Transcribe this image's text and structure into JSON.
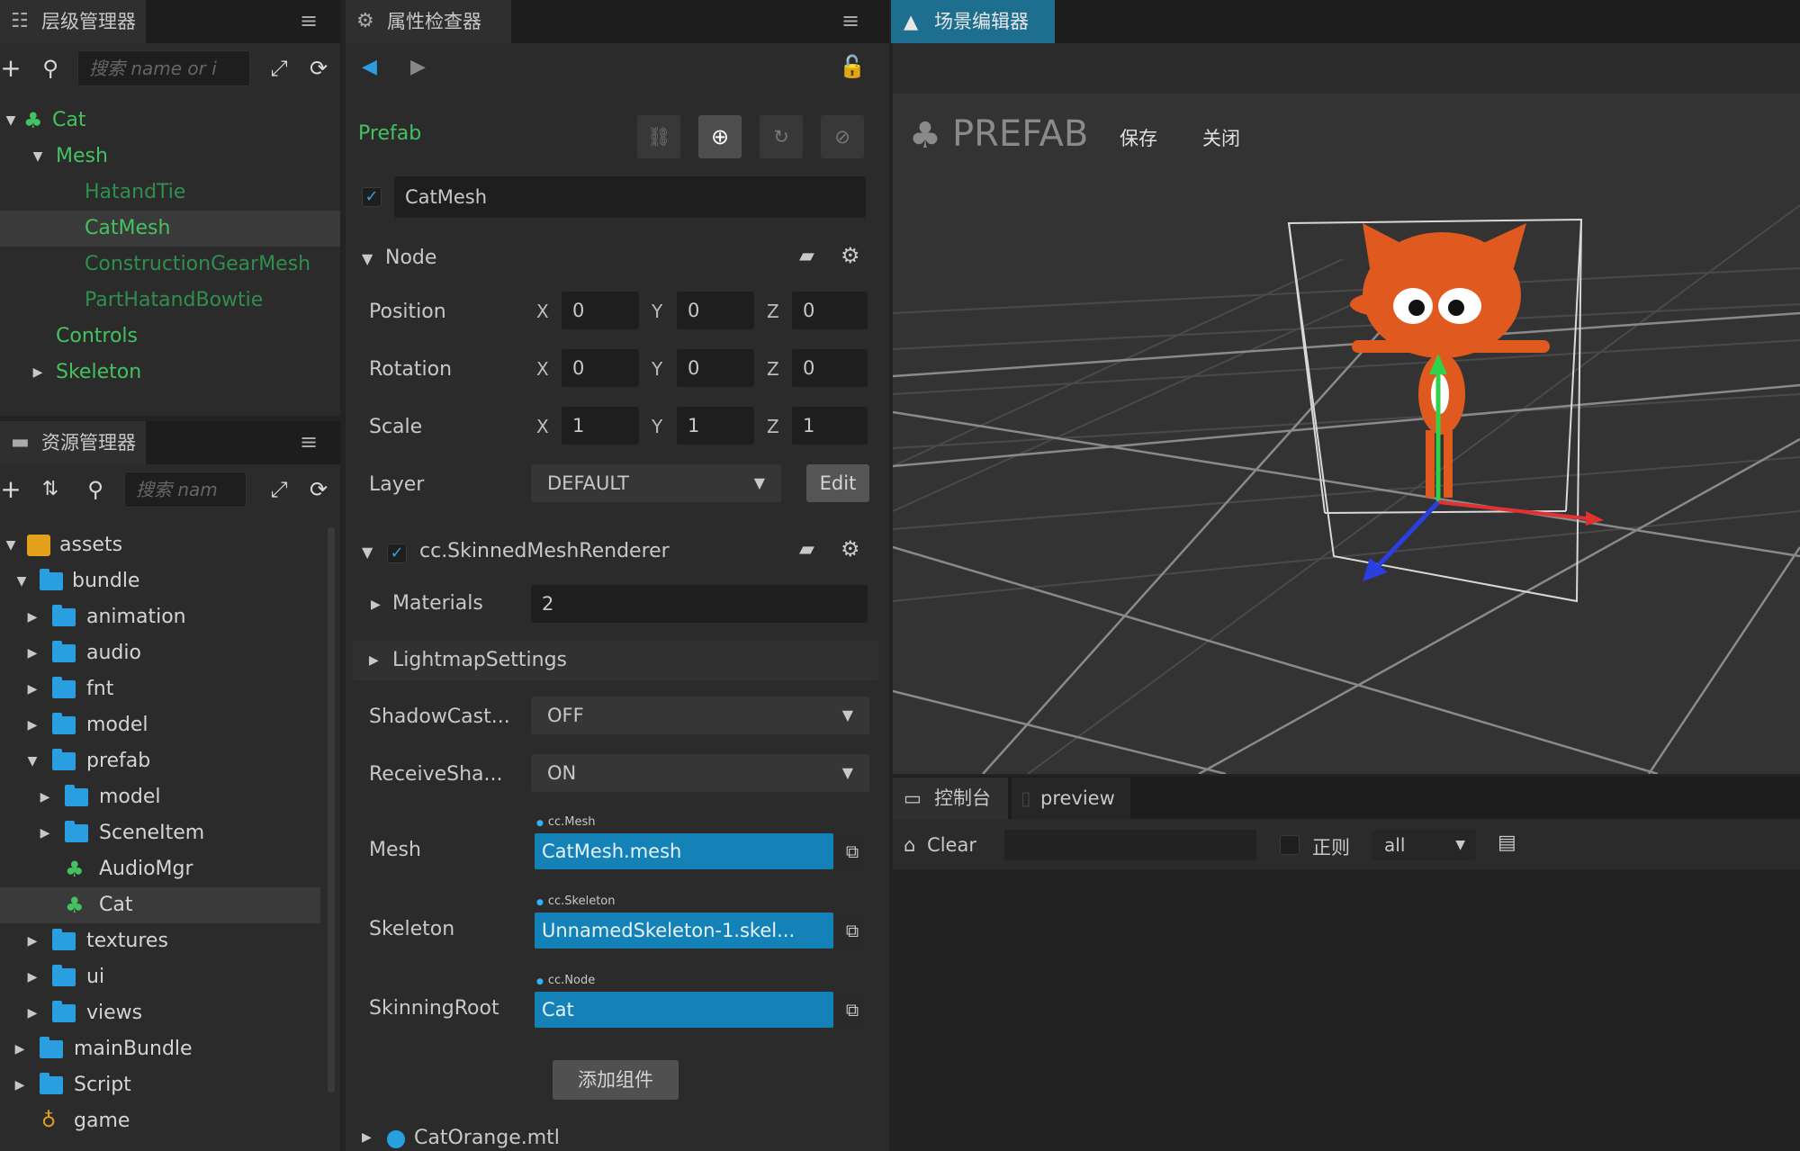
{
  "hierarchy": {
    "tab_title": "层级管理器",
    "search_placeholder": "搜索 name or i",
    "nodes": [
      {
        "label": "Cat"
      },
      {
        "label": "Mesh"
      },
      {
        "label": "HatandTie"
      },
      {
        "label": "CatMesh"
      },
      {
        "label": "ConstructionGearMesh"
      },
      {
        "label": "PartHatandBowtie"
      },
      {
        "label": "Controls"
      },
      {
        "label": "Skeleton"
      }
    ]
  },
  "assets": {
    "tab_title": "资源管理器",
    "search_placeholder": "搜索 nam",
    "items": [
      {
        "label": "assets"
      },
      {
        "label": "bundle"
      },
      {
        "label": "animation"
      },
      {
        "label": "audio"
      },
      {
        "label": "fnt"
      },
      {
        "label": "model"
      },
      {
        "label": "prefab"
      },
      {
        "label": "model"
      },
      {
        "label": "SceneItem"
      },
      {
        "label": "AudioMgr"
      },
      {
        "label": "Cat"
      },
      {
        "label": "textures"
      },
      {
        "label": "ui"
      },
      {
        "label": "views"
      },
      {
        "label": "mainBundle"
      },
      {
        "label": "Script"
      },
      {
        "label": "game"
      }
    ]
  },
  "inspector": {
    "tab_title": "属性检查器",
    "prefab_label": "Prefab",
    "node_name": "CatMesh",
    "node_section": "Node",
    "position_label": "Position",
    "rotation_label": "Rotation",
    "scale_label": "Scale",
    "axis_x": "X",
    "axis_y": "Y",
    "axis_z": "Z",
    "position": {
      "x": "0",
      "y": "0",
      "z": "0"
    },
    "rotation": {
      "x": "0",
      "y": "0",
      "z": "0"
    },
    "scale": {
      "x": "1",
      "y": "1",
      "z": "1"
    },
    "layer_label": "Layer",
    "layer_value": "DEFAULT",
    "edit_label": "Edit",
    "component_title": "cc.SkinnedMeshRenderer",
    "materials_label": "Materials",
    "materials_value": "2",
    "lightmap_label": "LightmapSettings",
    "shadow_label": "ShadowCast...",
    "shadow_value": "OFF",
    "receive_label": "ReceiveSha...",
    "receive_value": "ON",
    "mesh_label": "Mesh",
    "mesh_type": "cc.Mesh",
    "mesh_value": "CatMesh.mesh",
    "skeleton_label": "Skeleton",
    "skeleton_type": "cc.Skeleton",
    "skeleton_value": "UnnamedSkeleton-1.skel...",
    "root_label": "SkinningRoot",
    "root_type": "cc.Node",
    "root_value": "Cat",
    "add_component": "添加组件",
    "material_item": "CatOrange.mtl"
  },
  "scene": {
    "tab_title": "场景编辑器",
    "prefab_badge": "PREFAB",
    "save_label": "保存",
    "close_label": "关闭"
  },
  "console": {
    "tab_console": "控制台",
    "tab_preview": "preview",
    "clear_label": "Clear",
    "regex_label": "正则",
    "filter_value": "all"
  },
  "colors": {
    "node_green": "#44c25f",
    "asset_blue": "#1482b6",
    "folder_blue": "#2a9fe0",
    "accent_tab": "#1e6f8f"
  }
}
